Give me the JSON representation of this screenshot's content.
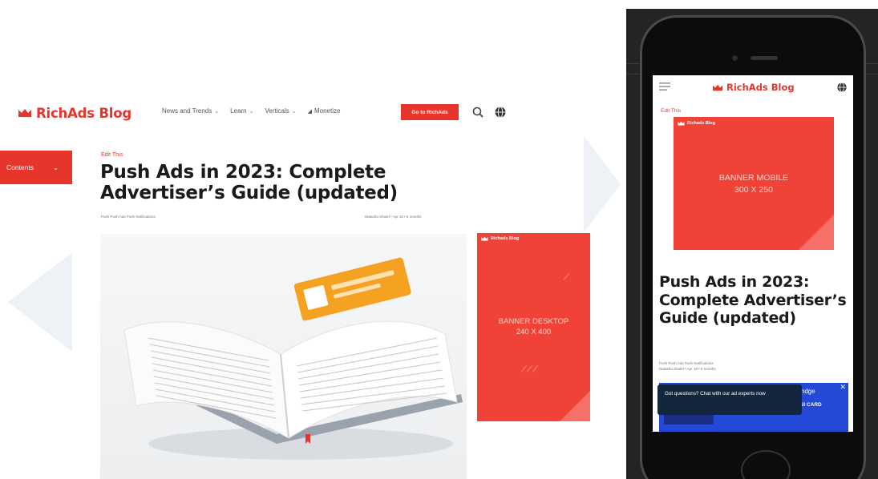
{
  "desktop": {
    "logo": "RichAds Blog",
    "nav": [
      {
        "label": "News and Trends",
        "chevron": true
      },
      {
        "label": "Learn",
        "chevron": true
      },
      {
        "label": "Verticals",
        "chevron": true
      },
      {
        "label": "Monetize",
        "chevron": false
      }
    ],
    "cta_label": "Go to RichAds",
    "contents_label": "Contents",
    "edit_label": "Edit This",
    "title": "Push Ads in 2023: Complete Advertiser’s Guide (updated)",
    "tags": "Push  Push Ads  Push Notifications",
    "meta": "Natasha Shatel  •  Apr 18  •  5 months",
    "banner": {
      "brand": "Richads Blog",
      "line1": "BANNER DESKTOP",
      "line2": "240 X 400"
    }
  },
  "mobile": {
    "logo": "RichAds Blog",
    "edit_label": "Edit This",
    "banner": {
      "brand": "Richads Blog",
      "line1": "BANNER MOBILE",
      "line2": "300 X 250"
    },
    "title": "Push Ads in 2023: Complete Advertiser’s Guide (updated)",
    "tags": "Push  Push Ads  Push Notifications",
    "meta": "Natasha Shatel  •  Apr 18  •  5 months",
    "chat_text": "Got questions? Chat with our ad experts now",
    "ad_text1": "pendge",
    "ad_text2": "SI CARD",
    "ad_close": "✕"
  },
  "icons": [
    "crown-logo",
    "search-icon",
    "globe-icon",
    "hamburger-icon",
    "chevron-down-icon"
  ],
  "colors": {
    "brand_red": "#e8352b",
    "banner_red": "#f04236",
    "ad_blue": "#2349d6",
    "chat_navy": "#14263d",
    "phone_bg": "#242424"
  }
}
